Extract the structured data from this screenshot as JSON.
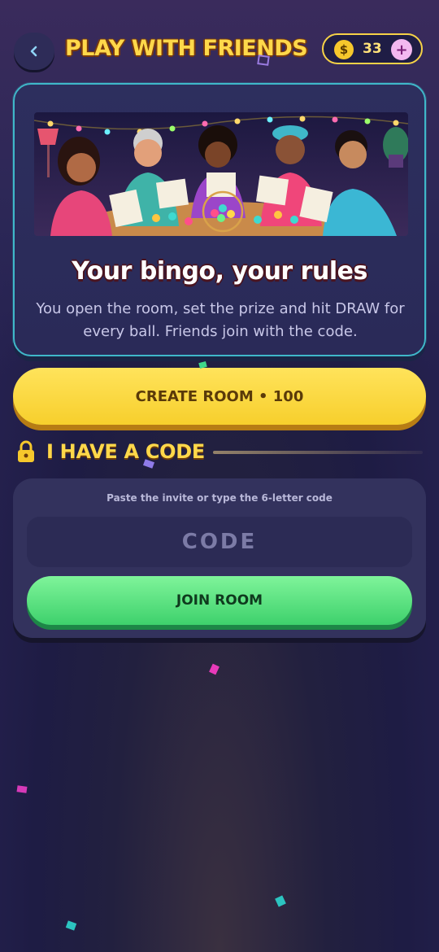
{
  "header": {
    "title": "PLAY WITH FRIENDS",
    "coins": "33",
    "coin_symbol": "$",
    "add_symbol": "+"
  },
  "hero": {
    "title": "Your bingo, your rules",
    "description": "You open the room, set the prize and hit DRAW for every ball. Friends join with the code."
  },
  "create_room": {
    "label": "CREATE ROOM • 100"
  },
  "join_section": {
    "heading": "I HAVE A CODE",
    "hint": "Paste the invite or type the 6-letter code",
    "code_placeholder": "CODE",
    "join_label": "JOIN ROOM"
  },
  "colors": {
    "accent_yellow": "#ffd84a",
    "teal_border": "#3fb7c9",
    "join_green": "#3ed16c",
    "create_yellow": "#f7cf2c"
  }
}
